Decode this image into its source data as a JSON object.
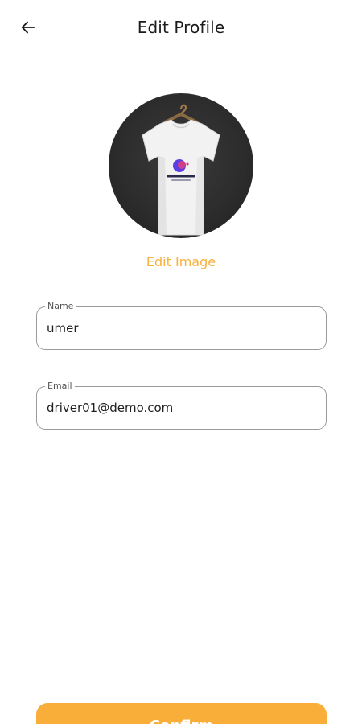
{
  "header": {
    "title": "Edit Profile",
    "back_icon": "arrow-left-icon"
  },
  "avatar": {
    "image_subject": "t-shirt-on-hanger",
    "edit_label": "Edit Image",
    "accent_color": "#f8b03c"
  },
  "form": {
    "name": {
      "label": "Name",
      "value": "umer"
    },
    "email": {
      "label": "Email",
      "value": "driver01@demo.com"
    }
  },
  "actions": {
    "confirm_label": "Confirm",
    "confirm_color": "#f9ae3a"
  }
}
